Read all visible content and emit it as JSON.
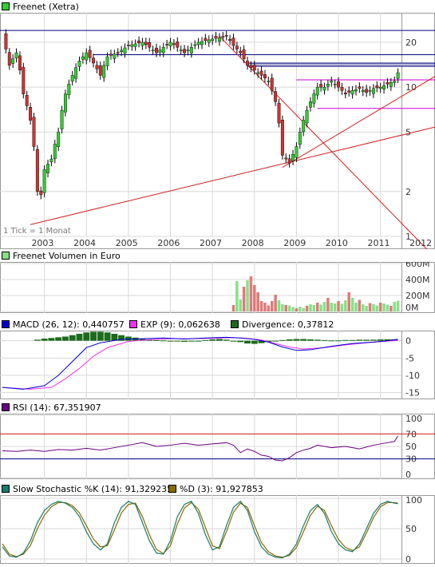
{
  "colors": {
    "up": "#33cc33",
    "down": "#cc3333",
    "grid": "#d8d8d8",
    "frame": "#999999",
    "resistance": "#000080",
    "support": "#d02020",
    "channel": "#cc00cc",
    "macd": "#0000cc",
    "exp": "#ee33ee",
    "divergence": "#1c6b1c",
    "rsi": "#6a0080",
    "stoch_k": "#1a7a6a",
    "stoch_d": "#8a6a00",
    "volume_pos": "#88e088",
    "volume_neg": "#e07a7a"
  },
  "chart_data": [
    {
      "id": "price",
      "type": "candlestick",
      "title": "Freenet (Xetra)",
      "scale": "log",
      "ylim": [
        1,
        30
      ],
      "yticks": [
        1,
        2,
        5,
        10,
        20
      ],
      "xticks": [
        "2003",
        "2004",
        "2005",
        "2006",
        "2007",
        "2008",
        "2009",
        "2010",
        "2011",
        "2012"
      ],
      "tick_note": "1 Tick = 1 Monat",
      "x_unit": "months since 2002-01",
      "series": [
        {
          "t": 0,
          "v": 22
        },
        {
          "t": 2,
          "v": 14
        },
        {
          "t": 4,
          "v": 17
        },
        {
          "t": 6,
          "v": 9
        },
        {
          "t": 8,
          "v": 6
        },
        {
          "t": 9,
          "v": 4
        },
        {
          "t": 10,
          "v": 2
        },
        {
          "t": 11,
          "v": 1.9
        },
        {
          "t": 12,
          "v": 2.8
        },
        {
          "t": 14,
          "v": 3.3
        },
        {
          "t": 16,
          "v": 5
        },
        {
          "t": 18,
          "v": 9
        },
        {
          "t": 20,
          "v": 12
        },
        {
          "t": 22,
          "v": 15
        },
        {
          "t": 24,
          "v": 17
        },
        {
          "t": 26,
          "v": 14.5
        },
        {
          "t": 28,
          "v": 12
        },
        {
          "t": 30,
          "v": 16
        },
        {
          "t": 33,
          "v": 17
        },
        {
          "t": 36,
          "v": 19
        },
        {
          "t": 40,
          "v": 20
        },
        {
          "t": 44,
          "v": 17
        },
        {
          "t": 48,
          "v": 20
        },
        {
          "t": 52,
          "v": 17
        },
        {
          "t": 56,
          "v": 20
        },
        {
          "t": 60,
          "v": 21
        },
        {
          "t": 64,
          "v": 22
        },
        {
          "t": 66,
          "v": 19
        },
        {
          "t": 68,
          "v": 17
        },
        {
          "t": 70,
          "v": 14
        },
        {
          "t": 72,
          "v": 13
        },
        {
          "t": 74,
          "v": 12
        },
        {
          "t": 76,
          "v": 11
        },
        {
          "t": 78,
          "v": 8
        },
        {
          "t": 80,
          "v": 3.5
        },
        {
          "t": 82,
          "v": 3.1
        },
        {
          "t": 84,
          "v": 4
        },
        {
          "t": 86,
          "v": 6
        },
        {
          "t": 88,
          "v": 8
        },
        {
          "t": 90,
          "v": 10
        },
        {
          "t": 92,
          "v": 10
        },
        {
          "t": 94,
          "v": 11
        },
        {
          "t": 96,
          "v": 10
        },
        {
          "t": 98,
          "v": 9
        },
        {
          "t": 100,
          "v": 9.5
        },
        {
          "t": 102,
          "v": 9.8
        },
        {
          "t": 104,
          "v": 9.2
        },
        {
          "t": 106,
          "v": 9.8
        },
        {
          "t": 108,
          "v": 10
        },
        {
          "t": 110,
          "v": 10.5
        },
        {
          "t": 112,
          "v": 11
        },
        {
          "t": 113,
          "v": 12.5
        }
      ],
      "hlines": [
        {
          "value": 24,
          "color": "resistance"
        },
        {
          "value": 16.5,
          "color": "resistance"
        },
        {
          "value": 14.5,
          "color": "resistance"
        },
        {
          "value": 13.8,
          "color": "resistance"
        },
        {
          "value": 11.2,
          "color": "channel"
        },
        {
          "value": 7.2,
          "color": "channel"
        }
      ]
    },
    {
      "id": "volume",
      "type": "bar",
      "title": "Freenet Volumen in Euro",
      "ylim": [
        0,
        600000000
      ],
      "yticks": [
        "0M",
        "200M",
        "400M",
        "600M"
      ],
      "values": [
        80,
        380,
        150,
        310,
        390,
        440,
        330,
        240,
        130,
        110,
        75,
        130,
        210,
        140,
        90,
        80,
        75,
        55,
        40,
        60,
        45,
        70,
        90,
        80,
        110,
        85,
        120,
        170,
        110,
        100,
        130,
        95,
        140,
        240,
        170,
        110,
        145,
        90,
        70,
        105,
        90,
        75,
        110,
        100,
        85,
        70,
        120,
        135
      ],
      "start_t": 66
    },
    {
      "id": "macd",
      "type": "line",
      "legend": [
        {
          "label": "MACD (26, 12): 0,440757",
          "color": "macd"
        },
        {
          "label": "EXP (9): 0,062638",
          "color": "exp"
        },
        {
          "label": "Divergence: 0,37812",
          "color": "divergence"
        }
      ],
      "ylim": [
        -16,
        2
      ],
      "yticks": [
        "0",
        "-5",
        "-10",
        "-15"
      ],
      "ytick_values": [
        0,
        -5,
        -10,
        -15
      ],
      "macd": [
        [
          0,
          -13.5
        ],
        [
          6,
          -14
        ],
        [
          12,
          -13
        ],
        [
          16,
          -10
        ],
        [
          20,
          -6
        ],
        [
          24,
          -2
        ],
        [
          28,
          -0.6
        ],
        [
          34,
          0.4
        ],
        [
          40,
          0.6
        ],
        [
          46,
          0.8
        ],
        [
          52,
          0.5
        ],
        [
          58,
          0.8
        ],
        [
          64,
          1
        ],
        [
          68,
          0.8
        ],
        [
          72,
          0.4
        ],
        [
          76,
          -0.4
        ],
        [
          80,
          -1.8
        ],
        [
          84,
          -2.8
        ],
        [
          88,
          -2.6
        ],
        [
          94,
          -1.6
        ],
        [
          100,
          -0.8
        ],
        [
          106,
          -0.4
        ],
        [
          110,
          0
        ],
        [
          113,
          0.44
        ]
      ],
      "exp": [
        [
          0,
          -13.5
        ],
        [
          8,
          -14
        ],
        [
          14,
          -13.5
        ],
        [
          18,
          -11
        ],
        [
          22,
          -8
        ],
        [
          26,
          -4.5
        ],
        [
          30,
          -2
        ],
        [
          36,
          -0.2
        ],
        [
          42,
          0.3
        ],
        [
          48,
          0.6
        ],
        [
          54,
          0.6
        ],
        [
          60,
          0.7
        ],
        [
          66,
          0.9
        ],
        [
          70,
          0.7
        ],
        [
          74,
          0.2
        ],
        [
          78,
          -0.8
        ],
        [
          82,
          -1.8
        ],
        [
          86,
          -2.4
        ],
        [
          92,
          -2
        ],
        [
          98,
          -1.2
        ],
        [
          104,
          -0.6
        ],
        [
          110,
          -0.1
        ],
        [
          113,
          0.06
        ]
      ],
      "divergence": [
        0.3,
        0.6,
        0.8,
        1,
        1.2,
        1.6,
        2,
        2.4,
        2.6,
        2.6,
        2.4,
        2,
        1.6,
        1.2,
        0.9,
        0.6,
        0.4,
        0.2,
        0.1,
        -0.1,
        -0.2,
        -0.3,
        -0.2,
        -0.1,
        0.2,
        0.4,
        0.5,
        0.3,
        -0.1,
        -0.4,
        -0.8,
        -0.9,
        -0.7,
        -0.4,
        -0.2,
        0.2,
        0.4,
        0.5,
        0.5,
        0.4,
        0.3,
        0.2,
        0.1,
        0.1,
        0.2,
        0.2,
        0.3,
        0.3,
        0.3,
        0.4,
        0.4,
        0.4
      ],
      "divergence_start_t": 10,
      "divergence_step": 2
    },
    {
      "id": "rsi",
      "type": "line",
      "legend": [
        {
          "label": "RSI (14): 67,351907",
          "color": "rsi"
        }
      ],
      "ylim": [
        0,
        100
      ],
      "yticks": [
        "0",
        "30",
        "50",
        "70",
        "100"
      ],
      "ytick_values": [
        0,
        30,
        50,
        70,
        100
      ],
      "bands": [
        {
          "value": 70,
          "color": "support"
        },
        {
          "value": 30,
          "color": "resistance"
        }
      ],
      "points": [
        [
          0,
          43
        ],
        [
          4,
          42
        ],
        [
          8,
          44
        ],
        [
          12,
          42
        ],
        [
          16,
          45
        ],
        [
          20,
          44
        ],
        [
          24,
          47
        ],
        [
          28,
          44
        ],
        [
          32,
          48
        ],
        [
          36,
          52
        ],
        [
          40,
          56
        ],
        [
          44,
          50
        ],
        [
          48,
          52
        ],
        [
          52,
          55
        ],
        [
          56,
          52
        ],
        [
          60,
          54
        ],
        [
          64,
          56
        ],
        [
          66,
          52
        ],
        [
          68,
          40
        ],
        [
          70,
          46
        ],
        [
          72,
          42
        ],
        [
          74,
          36
        ],
        [
          76,
          34
        ],
        [
          78,
          28
        ],
        [
          80,
          27
        ],
        [
          82,
          32
        ],
        [
          84,
          40
        ],
        [
          86,
          44
        ],
        [
          88,
          47
        ],
        [
          90,
          52
        ],
        [
          94,
          48
        ],
        [
          98,
          50
        ],
        [
          102,
          46
        ],
        [
          106,
          52
        ],
        [
          110,
          56
        ],
        [
          112,
          58
        ],
        [
          113,
          67
        ]
      ]
    },
    {
      "id": "stochastic",
      "type": "line",
      "legend": [
        {
          "label": "Slow Stochastic %K (14): 91,329235",
          "color": "stoch_k"
        },
        {
          "label": "%D (3): 91,927853",
          "color": "stoch_d"
        }
      ],
      "ylim": [
        0,
        100
      ],
      "yticks": [
        "0",
        "50",
        "100"
      ],
      "ytick_values": [
        0,
        50,
        100
      ],
      "k": [
        [
          0,
          20
        ],
        [
          2,
          5
        ],
        [
          4,
          3
        ],
        [
          6,
          10
        ],
        [
          8,
          30
        ],
        [
          10,
          60
        ],
        [
          12,
          80
        ],
        [
          14,
          90
        ],
        [
          16,
          95
        ],
        [
          18,
          92
        ],
        [
          20,
          85
        ],
        [
          22,
          70
        ],
        [
          24,
          45
        ],
        [
          26,
          25
        ],
        [
          28,
          15
        ],
        [
          30,
          25
        ],
        [
          32,
          60
        ],
        [
          34,
          85
        ],
        [
          36,
          95
        ],
        [
          38,
          90
        ],
        [
          40,
          60
        ],
        [
          42,
          30
        ],
        [
          44,
          10
        ],
        [
          46,
          8
        ],
        [
          48,
          30
        ],
        [
          50,
          70
        ],
        [
          52,
          90
        ],
        [
          54,
          95
        ],
        [
          56,
          75
        ],
        [
          58,
          40
        ],
        [
          60,
          15
        ],
        [
          62,
          20
        ],
        [
          64,
          55
        ],
        [
          66,
          85
        ],
        [
          68,
          95
        ],
        [
          70,
          80
        ],
        [
          72,
          45
        ],
        [
          74,
          20
        ],
        [
          76,
          8
        ],
        [
          78,
          3
        ],
        [
          80,
          2
        ],
        [
          82,
          8
        ],
        [
          84,
          25
        ],
        [
          86,
          55
        ],
        [
          88,
          80
        ],
        [
          90,
          90
        ],
        [
          92,
          75
        ],
        [
          94,
          45
        ],
        [
          96,
          25
        ],
        [
          98,
          15
        ],
        [
          100,
          12
        ],
        [
          102,
          25
        ],
        [
          104,
          50
        ],
        [
          106,
          75
        ],
        [
          108,
          90
        ],
        [
          110,
          95
        ],
        [
          112,
          92
        ],
        [
          113,
          91
        ]
      ],
      "d": [
        [
          0,
          25
        ],
        [
          2,
          8
        ],
        [
          4,
          4
        ],
        [
          6,
          8
        ],
        [
          8,
          22
        ],
        [
          10,
          50
        ],
        [
          12,
          72
        ],
        [
          14,
          86
        ],
        [
          16,
          93
        ],
        [
          18,
          93
        ],
        [
          20,
          88
        ],
        [
          22,
          76
        ],
        [
          24,
          55
        ],
        [
          26,
          33
        ],
        [
          28,
          20
        ],
        [
          30,
          22
        ],
        [
          32,
          48
        ],
        [
          34,
          76
        ],
        [
          36,
          90
        ],
        [
          38,
          92
        ],
        [
          40,
          70
        ],
        [
          42,
          40
        ],
        [
          44,
          16
        ],
        [
          46,
          9
        ],
        [
          48,
          22
        ],
        [
          50,
          58
        ],
        [
          52,
          84
        ],
        [
          54,
          93
        ],
        [
          56,
          82
        ],
        [
          58,
          52
        ],
        [
          60,
          22
        ],
        [
          62,
          17
        ],
        [
          64,
          45
        ],
        [
          66,
          77
        ],
        [
          68,
          92
        ],
        [
          70,
          85
        ],
        [
          72,
          55
        ],
        [
          74,
          27
        ],
        [
          76,
          12
        ],
        [
          78,
          5
        ],
        [
          80,
          3
        ],
        [
          82,
          6
        ],
        [
          84,
          19
        ],
        [
          86,
          45
        ],
        [
          88,
          72
        ],
        [
          90,
          87
        ],
        [
          92,
          80
        ],
        [
          94,
          55
        ],
        [
          96,
          32
        ],
        [
          98,
          19
        ],
        [
          100,
          14
        ],
        [
          102,
          20
        ],
        [
          104,
          43
        ],
        [
          106,
          68
        ],
        [
          108,
          86
        ],
        [
          110,
          93
        ],
        [
          112,
          93
        ],
        [
          113,
          92
        ]
      ]
    }
  ]
}
